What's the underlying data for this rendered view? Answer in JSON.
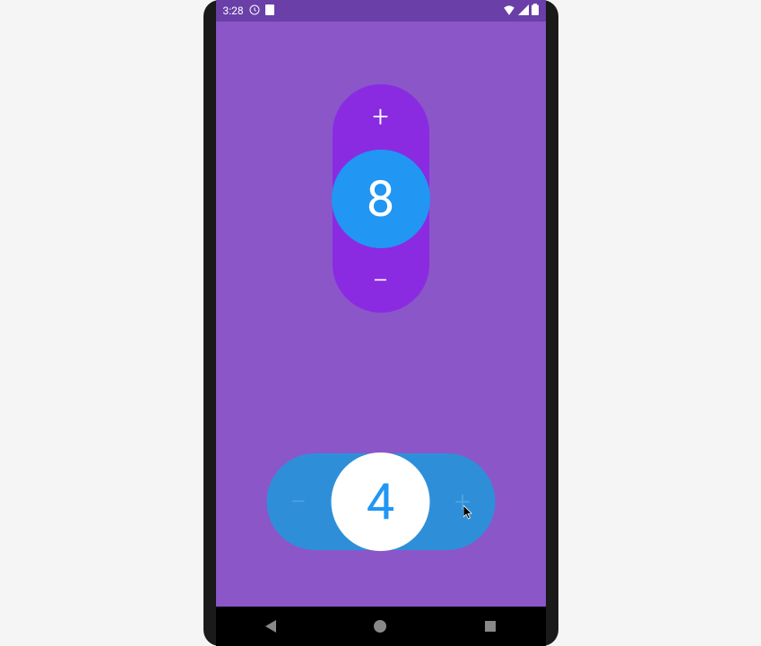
{
  "status_bar": {
    "time": "3:28"
  },
  "stepper_vertical": {
    "plus_label": "+",
    "minus_label": "−",
    "value": "8"
  },
  "stepper_horizontal": {
    "minus_label": "−",
    "plus_label": "+",
    "value": "4"
  }
}
